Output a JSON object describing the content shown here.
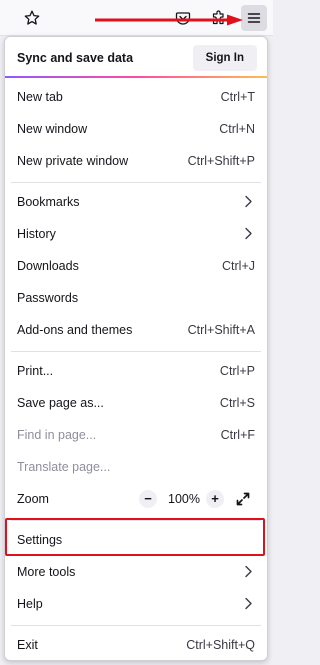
{
  "toolbar": {
    "icons": [
      "star-icon",
      "pocket-icon",
      "extensions-icon",
      "hamburger-menu-icon"
    ]
  },
  "menu": {
    "sync": {
      "label": "Sync and save data",
      "button": "Sign In"
    },
    "items": [
      {
        "label": "New tab",
        "shortcut": "Ctrl+T"
      },
      {
        "label": "New window",
        "shortcut": "Ctrl+N"
      },
      {
        "label": "New private window",
        "shortcut": "Ctrl+Shift+P"
      },
      {
        "label": "Bookmarks",
        "submenu": true
      },
      {
        "label": "History",
        "submenu": true
      },
      {
        "label": "Downloads",
        "shortcut": "Ctrl+J"
      },
      {
        "label": "Passwords"
      },
      {
        "label": "Add-ons and themes",
        "shortcut": "Ctrl+Shift+A"
      },
      {
        "label": "Print...",
        "shortcut": "Ctrl+P"
      },
      {
        "label": "Save page as...",
        "shortcut": "Ctrl+S"
      },
      {
        "label": "Find in page...",
        "shortcut": "Ctrl+F",
        "disabled": true
      },
      {
        "label": "Translate page...",
        "disabled": true
      },
      {
        "label": "Settings"
      },
      {
        "label": "More tools",
        "submenu": true
      },
      {
        "label": "Help",
        "submenu": true
      },
      {
        "label": "Exit",
        "shortcut": "Ctrl+Shift+Q"
      }
    ],
    "zoom": {
      "label": "Zoom",
      "minus": "−",
      "value": "100%",
      "plus": "+"
    }
  },
  "colors": {
    "annotation": "#e0101c",
    "panel_bg": "#ffffff",
    "disabled_text": "#8f8f9d"
  }
}
